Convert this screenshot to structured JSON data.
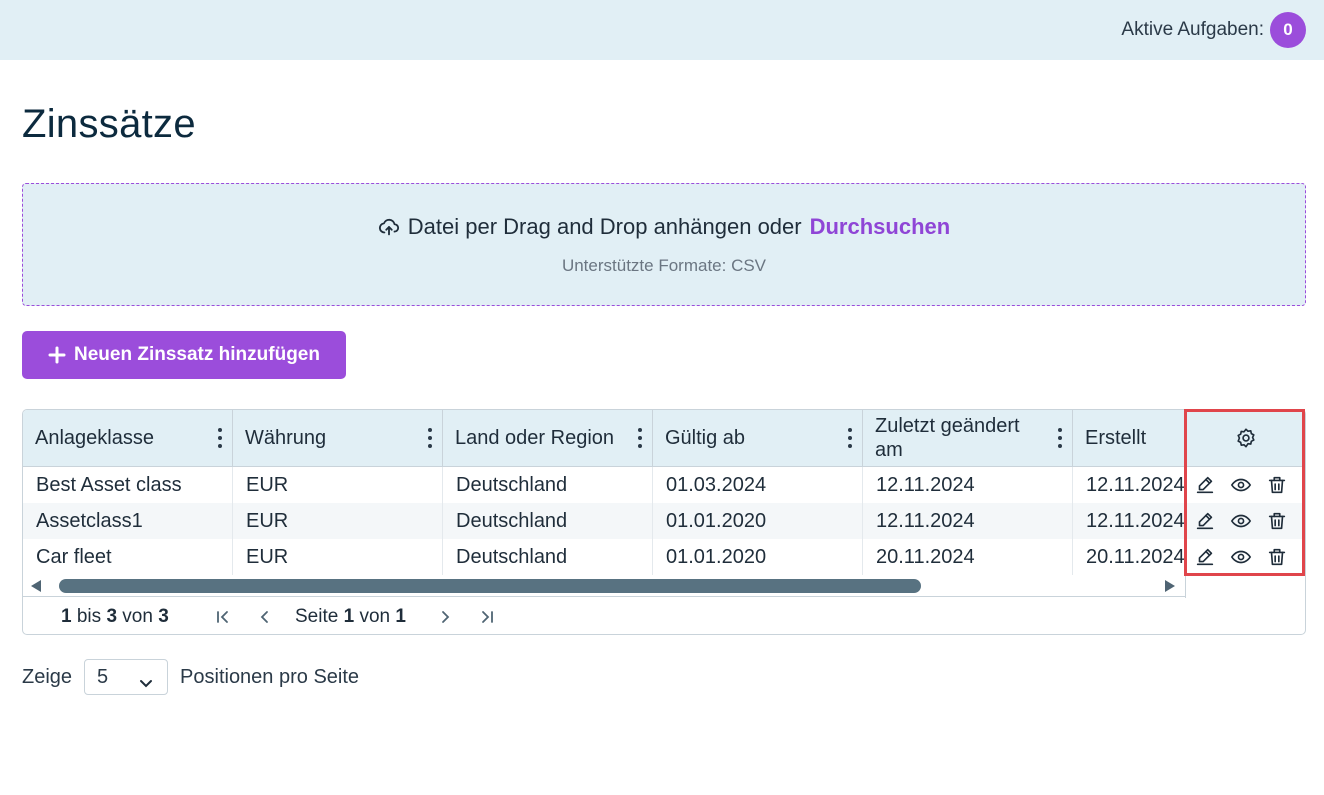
{
  "header": {
    "active_tasks_label": "Aktive Aufgaben:",
    "active_tasks_count": "0",
    "badge_color": "#9b4ddb",
    "background": "#e1eff5"
  },
  "page": {
    "title": "Zinssätze"
  },
  "upload": {
    "text": "Datei per Drag and Drop anhängen oder",
    "browse_label": "Durchsuchen",
    "formats": "Unterstützte Formate: CSV",
    "icon": "upload-cloud-icon"
  },
  "add_button": {
    "label": "Neuen Zinssatz hinzufügen",
    "icon": "plus-icon",
    "color": "#9b4ddb"
  },
  "table": {
    "columns": [
      {
        "label": "Anlageklasse"
      },
      {
        "label": "Währung"
      },
      {
        "label": "Land oder Region"
      },
      {
        "label": "Gültig ab"
      },
      {
        "label": "Zuletzt geändert am"
      },
      {
        "label": "Erstellt"
      }
    ],
    "actions_header_icon": "settings-icon",
    "rows": [
      {
        "cells": [
          "Best Asset class",
          "EUR",
          "Deutschland",
          "01.03.2024",
          "12.11.2024",
          "12.11.2024"
        ]
      },
      {
        "cells": [
          "Assetclass1",
          "EUR",
          "Deutschland",
          "01.01.2020",
          "12.11.2024",
          "12.11.2024"
        ]
      },
      {
        "cells": [
          "Car fleet",
          "EUR",
          "Deutschland",
          "01.01.2020",
          "20.11.2024",
          "20.11.2024"
        ]
      }
    ],
    "row_actions": [
      "edit-icon",
      "view-icon",
      "delete-icon"
    ]
  },
  "pagination": {
    "from": "1",
    "bis": "bis",
    "to": "3",
    "von": "von",
    "total": "3",
    "seite": "Seite",
    "page": "1",
    "page_of": "von",
    "page_count": "1"
  },
  "footer": {
    "prefix": "Zeige",
    "page_size": "5",
    "suffix": "Positionen pro Seite"
  },
  "highlight_color": "#e0454b"
}
